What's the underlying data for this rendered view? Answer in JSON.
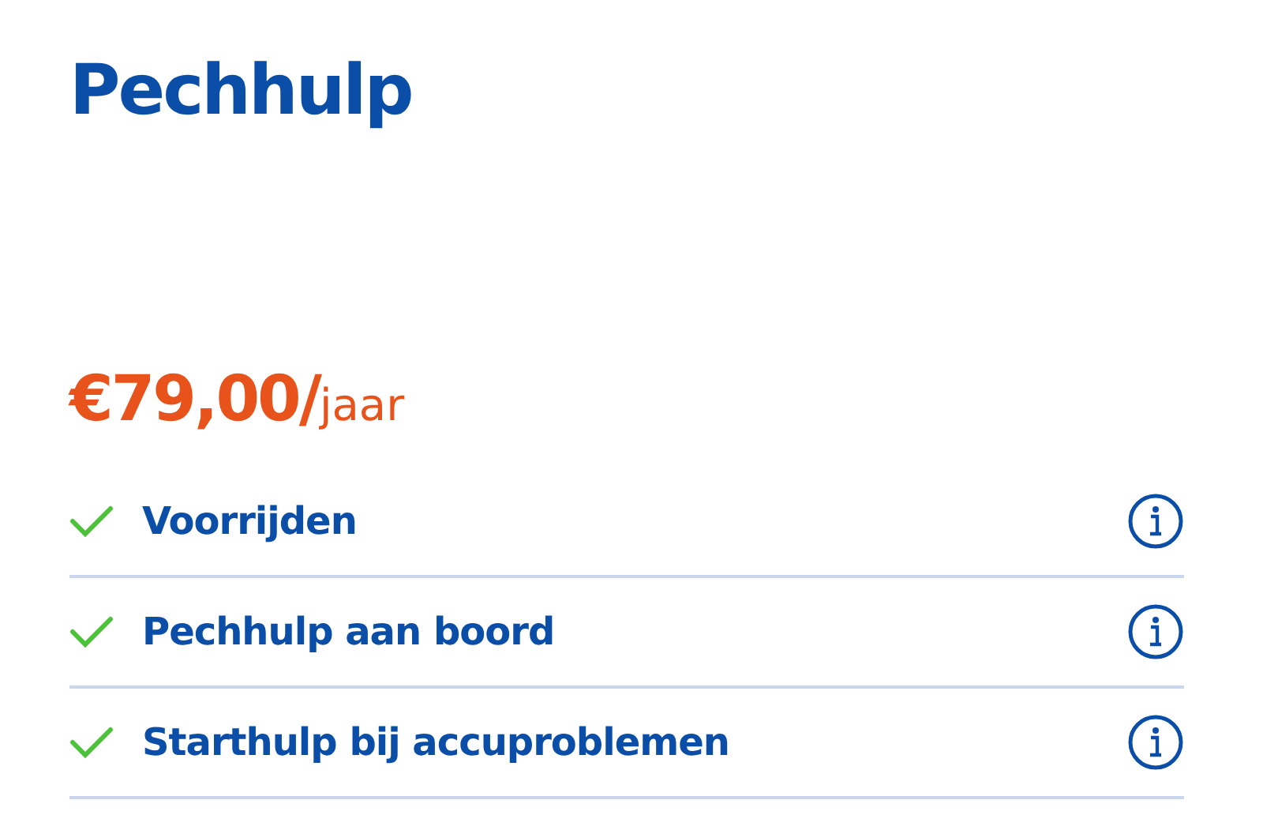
{
  "title": "Pechhulp",
  "price": {
    "amount": "€79,00/",
    "period": "jaar"
  },
  "features": [
    {
      "label": "Voorrijden"
    },
    {
      "label": "Pechhulp aan boord"
    },
    {
      "label": "Starthulp bij accuproblemen"
    }
  ]
}
